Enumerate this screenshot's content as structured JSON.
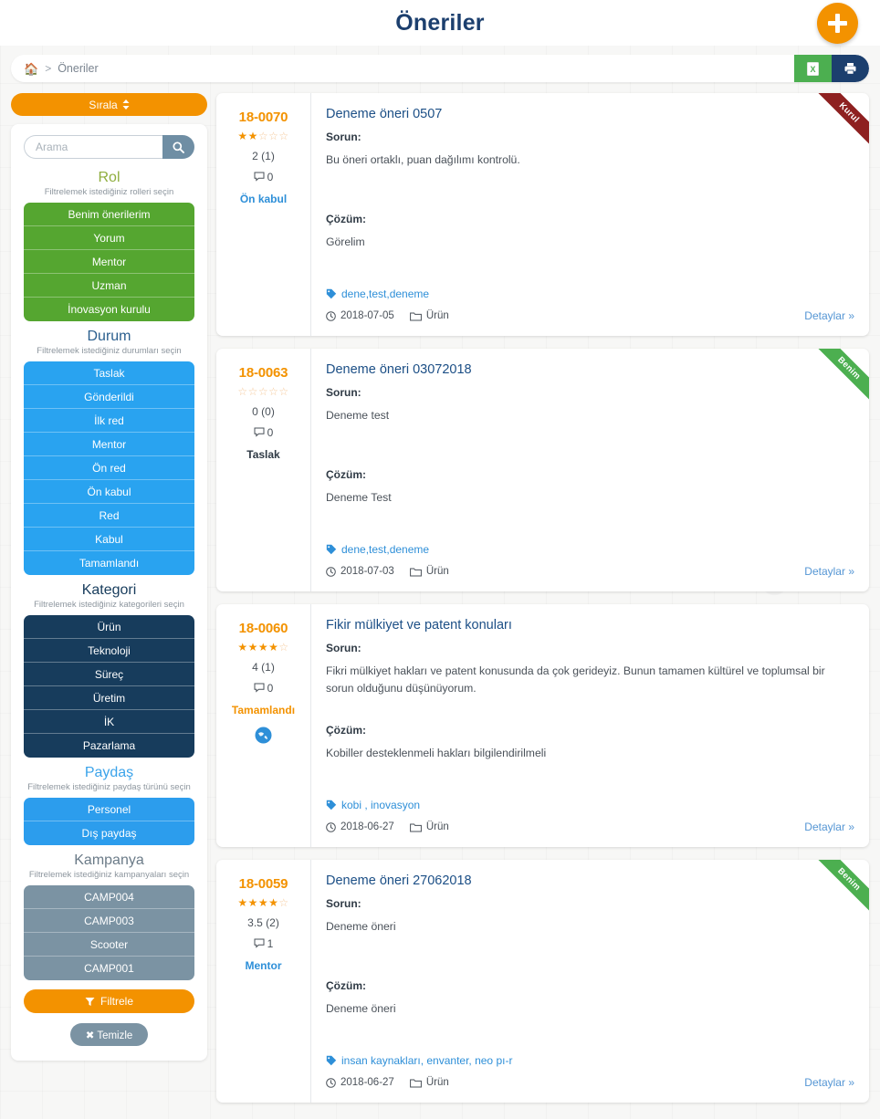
{
  "header": {
    "title": "Öneriler",
    "add_button_label": "+",
    "add_icon": "plus-icon"
  },
  "breadcrumb": {
    "home_icon": "home-icon",
    "separator": ">",
    "current": "Öneriler",
    "excel_icon": "excel-export-icon",
    "print_icon": "print-icon"
  },
  "sidebar": {
    "sort_label": "Sırala",
    "sort_icon": "sort-updown-icon",
    "search": {
      "placeholder": "Arama",
      "value": "",
      "button_icon": "search-icon"
    },
    "groups": [
      {
        "title": "Rol",
        "subtitle": "Filtrelemek istediğiniz rolleri seçin",
        "color": "#55a630",
        "options": [
          "Benim önerilerim",
          "Yorum",
          "Mentor",
          "Uzman",
          "İnovasyon kurulu"
        ]
      },
      {
        "title": "Durum",
        "subtitle": "Filtrelemek istediğiniz durumları seçin",
        "color": "#29a3f0",
        "options": [
          "Taslak",
          "Gönderildi",
          "İlk red",
          "Mentor",
          "Ön red",
          "Ön kabul",
          "Red",
          "Kabul",
          "Tamamlandı"
        ]
      },
      {
        "title": "Kategori",
        "subtitle": "Filtrelemek istediğiniz kategorileri seçin",
        "color": "#173c5c",
        "options": [
          "Ürün",
          "Teknoloji",
          "Süreç",
          "Üretim",
          "İK",
          "Pazarlama"
        ]
      },
      {
        "title": "Paydaş",
        "subtitle": "Filtrelemek istediğiniz paydaş türünü seçin",
        "color": "#2c9ded",
        "options": [
          "Personel",
          "Dış paydaş"
        ]
      },
      {
        "title": "Kampanya",
        "subtitle": "Filtrelemek istediğiniz kampanyaları seçin",
        "color": "#7b93a3",
        "options": [
          "CAMP004",
          "CAMP003",
          "Scooter",
          "CAMP001"
        ]
      }
    ],
    "filter_label": "Filtrele",
    "filter_icon": "funnel-icon",
    "clear_label": "Temizle",
    "clear_icon": "x-icon"
  },
  "labels": {
    "problem": "Sorun:",
    "solution": "Çözüm:",
    "details": "Detaylar »",
    "tag_icon": "tag-icon",
    "clock_icon": "clock-icon",
    "folder_icon": "folder-icon",
    "comment_icon": "comment-icon"
  },
  "cards": [
    {
      "code": "18-0070",
      "title": "Deneme öneri 0507",
      "rating": 2,
      "rating_text": "2 (1)",
      "stars_full": 2,
      "stars_half": 0,
      "comment_count": "0",
      "status": "Ön kabul",
      "status_color": "blue",
      "has_globe": false,
      "problem": "Bu öneri ortaklı, puan dağılımı kontrolü.",
      "solution": "Görelim",
      "tags": "dene,test,deneme",
      "date": "2018-07-05",
      "category": "Ürün",
      "ribbon": "Kurul",
      "ribbon_type": "kurul"
    },
    {
      "code": "18-0063",
      "title": "Deneme öneri 03072018",
      "rating": 0,
      "rating_text": "0 (0)",
      "stars_full": 0,
      "stars_half": 0,
      "comment_count": "0",
      "status": "Taslak",
      "status_color": "dark",
      "has_globe": false,
      "problem": "Deneme test",
      "solution": "Deneme Test",
      "tags": "dene,test,deneme",
      "date": "2018-07-03",
      "category": "Ürün",
      "ribbon": "Benim",
      "ribbon_type": "benim"
    },
    {
      "code": "18-0060",
      "title": "Fikir mülkiyet ve patent konuları",
      "rating": 4,
      "rating_text": "4 (1)",
      "stars_full": 4,
      "stars_half": 0,
      "comment_count": "0",
      "status": "Tamamlandı",
      "status_color": "orange",
      "has_globe": true,
      "globe_icon": "globe-icon",
      "problem": "Fikri mülkiyet hakları ve patent konusunda da çok gerideyiz. Bunun tamamen kültürel ve toplumsal bir sorun olduğunu düşünüyorum.",
      "solution": "Kobiller desteklenmeli hakları bilgilendirilmeli",
      "tags": "kobi , inovasyon",
      "date": "2018-06-27",
      "category": "Ürün",
      "ribbon": "",
      "ribbon_type": "none"
    },
    {
      "code": "18-0059",
      "title": "Deneme öneri 27062018",
      "rating": 3.5,
      "rating_text": "3.5 (2)",
      "stars_full": 3,
      "stars_half": 1,
      "comment_count": "1",
      "status": "Mentor",
      "status_color": "blue",
      "has_globe": false,
      "problem": "Deneme öneri",
      "solution": "Deneme öneri",
      "tags": "insan kaynakları, envanter, neo pı-r",
      "date": "2018-06-27",
      "category": "Ürün",
      "ribbon": "Benim",
      "ribbon_type": "benim"
    }
  ],
  "colors": {
    "accent_orange": "#f39200",
    "brand_navy": "#1c3f6e",
    "link_blue": "#2e8fd8",
    "green": "#4caf50",
    "ribbon_red": "#8e2020"
  }
}
